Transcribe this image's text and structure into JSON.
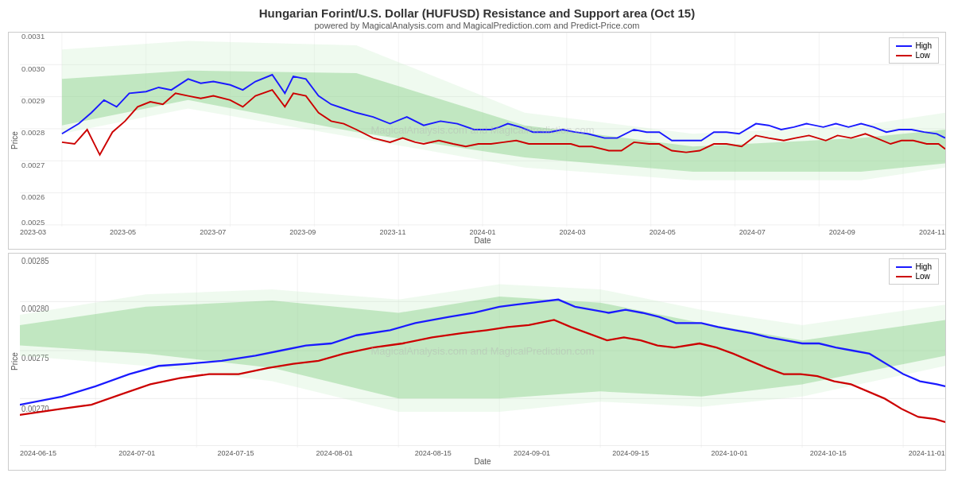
{
  "header": {
    "title": "Hungarian Forint/U.S. Dollar (HUFUSD) Resistance and Support area (Oct 15)",
    "subtitle": "powered by MagicalAnalysis.com and MagicalPrediction.com and Predict-Price.com"
  },
  "top_chart": {
    "y_label": "Price",
    "x_label": "Date",
    "y_ticks": [
      "0.0031",
      "0.0030",
      "0.0029",
      "0.0028",
      "0.0027",
      "0.0026",
      "0.0025"
    ],
    "x_ticks": [
      "2023-03",
      "2023-05",
      "2023-07",
      "2023-09",
      "2023-11",
      "2024-01",
      "2024-03",
      "2024-05",
      "2024-07",
      "2024-09",
      "2024-11"
    ],
    "legend": {
      "high_label": "High",
      "low_label": "Low",
      "high_color": "#1a1aff",
      "low_color": "#cc0000"
    },
    "watermark": "MagicalAnalysis.com and MagicalPrediction.com"
  },
  "bottom_chart": {
    "y_label": "Price",
    "x_label": "Date",
    "y_ticks": [
      "0.00285",
      "0.00280",
      "0.00275",
      "0.00270"
    ],
    "x_ticks": [
      "2024-06-15",
      "2024-07-01",
      "2024-07-15",
      "2024-08-01",
      "2024-08-15",
      "2024-09-01",
      "2024-09-15",
      "2024-10-01",
      "2024-10-15",
      "2024-11-01"
    ],
    "legend": {
      "high_label": "High",
      "low_label": "Low",
      "high_color": "#1a1aff",
      "low_color": "#cc0000"
    },
    "watermark": "MagicalAnalysis.com and MagicalPrediction.com"
  },
  "colors": {
    "high_line": "#1a1aff",
    "low_line": "#cc0000",
    "band_fill": "rgba(120,200,120,0.35)",
    "band_fill_light": "rgba(180,230,180,0.25)",
    "grid_line": "#e0e0e0"
  }
}
